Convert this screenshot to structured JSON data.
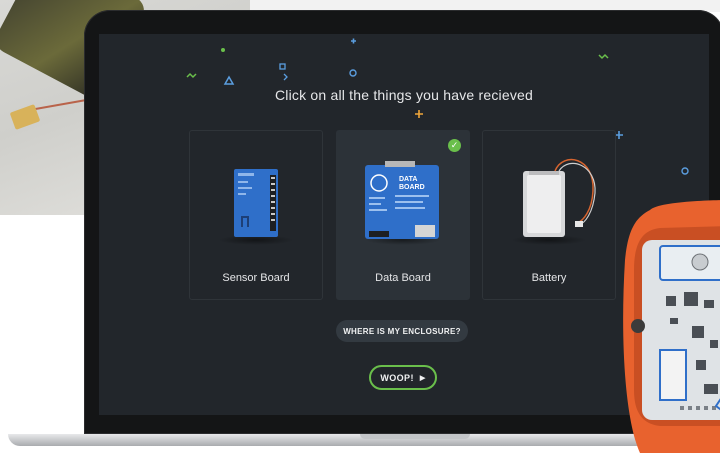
{
  "screen": {
    "title": "Click on all the things you have recieved",
    "cards": [
      {
        "label": "Sensor Board",
        "selected": false
      },
      {
        "label": "Data Board",
        "selected": true,
        "board_text": "DATA BOARD"
      },
      {
        "label": "Battery",
        "selected": false
      }
    ],
    "enclosure_button": "WHERE IS MY ENCLOSURE?",
    "woop_button": "WOOP!",
    "woop_arrow": "▶",
    "check_mark": "✓"
  },
  "colors": {
    "screen_bg": "#22262b",
    "accent_green": "#6abf4b",
    "board_blue": "#2f6fc9",
    "deco_blue": "#5b9ee0",
    "deco_orange": "#f0a63a",
    "device_orange": "#e8622e"
  },
  "icons": {
    "selected": "check-circle-icon",
    "next": "chevron-right-icon"
  }
}
